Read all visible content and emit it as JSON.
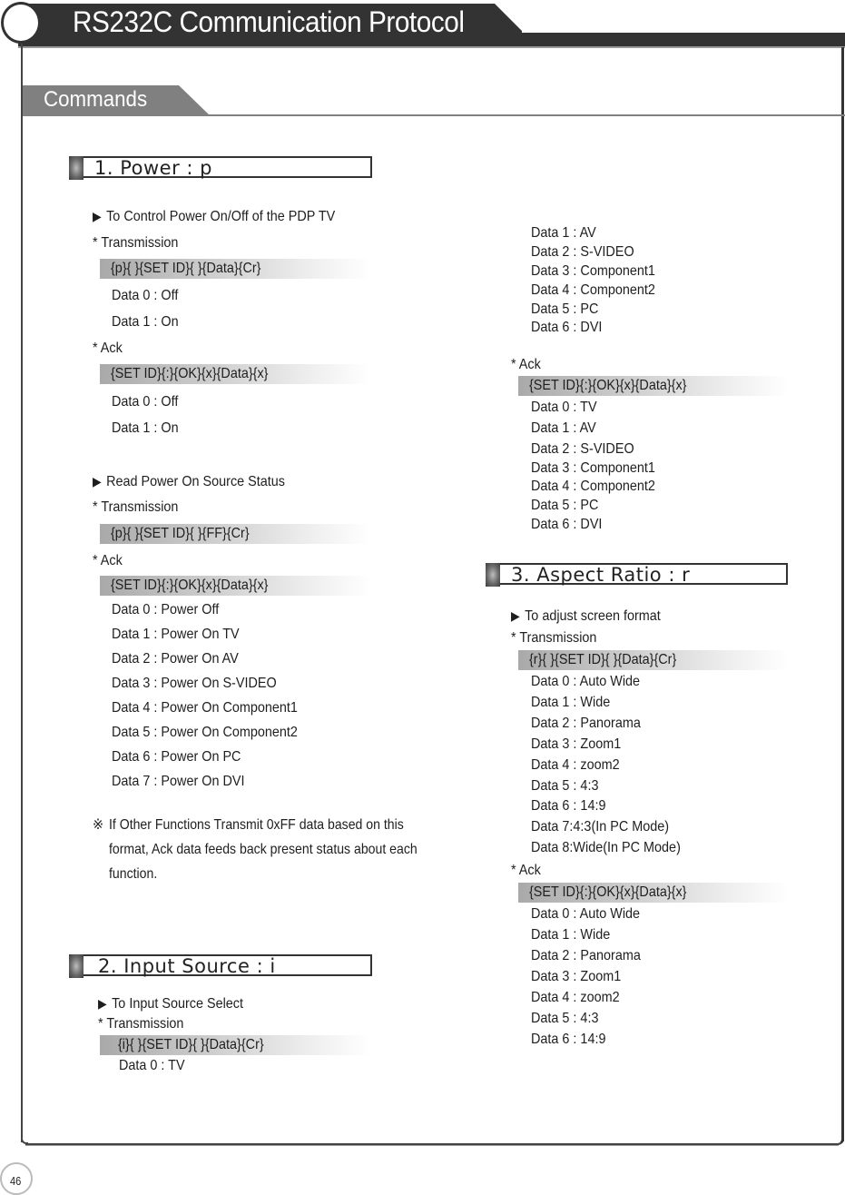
{
  "page": {
    "title": "RS232C Communication Protocol",
    "subtitle": "Commands",
    "page_number": "46"
  },
  "power": {
    "heading": "1. Power : p",
    "control": {
      "description": "To Control Power On/Off of the PDP TV",
      "transmission_label": "* Transmission",
      "transmission_code": "{p}{ }{SET ID}{ }{Data}{Cr}",
      "transmission_data": [
        "Data 0 : Off",
        "Data 1 : On"
      ],
      "ack_label": "* Ack",
      "ack_code": "{SET ID}{:}{OK}{x}{Data}{x}",
      "ack_data": [
        "Data 0 : Off",
        "Data 1 : On"
      ]
    },
    "status": {
      "description": "Read Power On Source Status",
      "transmission_label": "* Transmission",
      "transmission_code": "{p}{ }{SET ID}{ }{FF}{Cr}",
      "ack_label": "* Ack",
      "ack_code": "{SET ID}{:}{OK}{x}{Data}{x}",
      "ack_data": [
        "Data 0 : Power Off",
        "Data 1 : Power On TV",
        "Data 2 : Power On AV",
        "Data 3 : Power On S-VIDEO",
        "Data 4 : Power On Component1",
        "Data 5 : Power On Component2",
        "Data 6 : Power On PC",
        "Data 7 : Power On DVI"
      ]
    },
    "note_symbol": "※",
    "note": "If Other Functions Transmit 0xFF data based on this format, Ack data feeds back present status about each function."
  },
  "input_source": {
    "heading": "2. Input Source : i",
    "description": "To Input Source Select",
    "transmission_label": "* Transmission",
    "transmission_code": "{i}{ }{SET ID}{ }{Data}{Cr}",
    "transmission_data": [
      "Data 0 : TV",
      "Data 1 : AV",
      "Data 2 : S-VIDEO",
      "Data 3 : Component1",
      "Data 4 : Component2",
      "Data 5 : PC",
      "Data 6 : DVI"
    ],
    "ack_label": "* Ack",
    "ack_code": "{SET ID}{:}{OK}{x}{Data}{x}",
    "ack_data": [
      "Data 0 : TV",
      "Data 1 : AV",
      "Data 2 : S-VIDEO",
      "Data 3 : Component1",
      "Data 4 : Component2",
      "Data 5 : PC",
      "Data 6 : DVI"
    ]
  },
  "aspect_ratio": {
    "heading": "3. Aspect Ratio : r",
    "description": "To adjust screen format",
    "transmission_label": "* Transmission",
    "transmission_code": "{r}{ }{SET ID}{ }{Data}{Cr}",
    "transmission_data": [
      "Data 0 : Auto Wide",
      "Data 1 : Wide",
      "Data 2 : Panorama",
      "Data 3 : Zoom1",
      "Data 4 : zoom2",
      "Data 5 : 4:3",
      "Data 6 : 14:9",
      "Data 7:4:3(In PC Mode)",
      "Data 8:Wide(In PC Mode)"
    ],
    "ack_label": "* Ack",
    "ack_code": "{SET ID}{:}{OK}{x}{Data}{x}",
    "ack_data": [
      "Data 0 : Auto Wide",
      "Data 1 : Wide",
      "Data 2 : Panorama",
      "Data 3 : Zoom1",
      "Data 4 : zoom2",
      "Data 5 : 4:3",
      "Data 6 : 14:9"
    ]
  },
  "icons": {
    "bullet_arrow": "▶",
    "section_knob": "gray-gradient-tab"
  }
}
